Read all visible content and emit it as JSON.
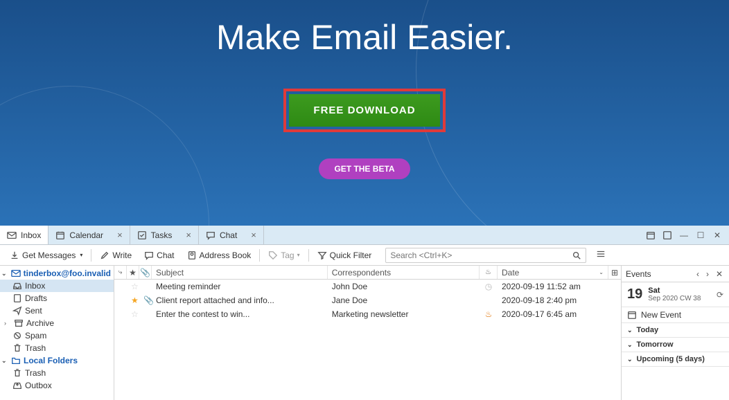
{
  "hero": {
    "title": "Make Email Easier.",
    "download_label": "FREE DOWNLOAD",
    "beta_label": "GET THE BETA"
  },
  "tabs": [
    {
      "label": "Inbox",
      "closable": false
    },
    {
      "label": "Calendar",
      "closable": true
    },
    {
      "label": "Tasks",
      "closable": true
    },
    {
      "label": "Chat",
      "closable": true
    }
  ],
  "toolbar": {
    "get_messages": "Get Messages",
    "write": "Write",
    "chat": "Chat",
    "address_book": "Address Book",
    "tag": "Tag",
    "quick_filter": "Quick Filter",
    "search_placeholder": "Search <Ctrl+K>"
  },
  "folders": {
    "account": "tinderbox@foo.invalid",
    "items": [
      {
        "label": "Inbox",
        "icon": "inbox"
      },
      {
        "label": "Drafts",
        "icon": "drafts"
      },
      {
        "label": "Sent",
        "icon": "sent"
      },
      {
        "label": "Archive",
        "icon": "archive",
        "expandable": true
      },
      {
        "label": "Spam",
        "icon": "spam"
      },
      {
        "label": "Trash",
        "icon": "trash"
      }
    ],
    "local_label": "Local Folders",
    "local_items": [
      {
        "label": "Trash",
        "icon": "trash"
      },
      {
        "label": "Outbox",
        "icon": "outbox"
      }
    ]
  },
  "columns": {
    "subject": "Subject",
    "correspondents": "Correspondents",
    "date": "Date"
  },
  "messages": [
    {
      "star": false,
      "attach": false,
      "subject": "Meeting reminder",
      "from": "John Doe",
      "fire": "clock",
      "date": "2020-09-19 11:52 am"
    },
    {
      "star": true,
      "attach": true,
      "subject": "Client report attached and info...",
      "from": "Jane Doe",
      "fire": "",
      "date": "2020-09-18 2:40 pm"
    },
    {
      "star": false,
      "attach": false,
      "subject": "Enter the contest to win...",
      "from": "Marketing newsletter",
      "fire": "fire",
      "date": "2020-09-17 6:45 am"
    }
  ],
  "events": {
    "header": "Events",
    "daynum": "19",
    "dayname": "Sat",
    "dateline": "Sep 2020 CW 38",
    "new_event": "New Event",
    "sections": [
      "Today",
      "Tomorrow",
      "Upcoming (5 days)"
    ]
  }
}
